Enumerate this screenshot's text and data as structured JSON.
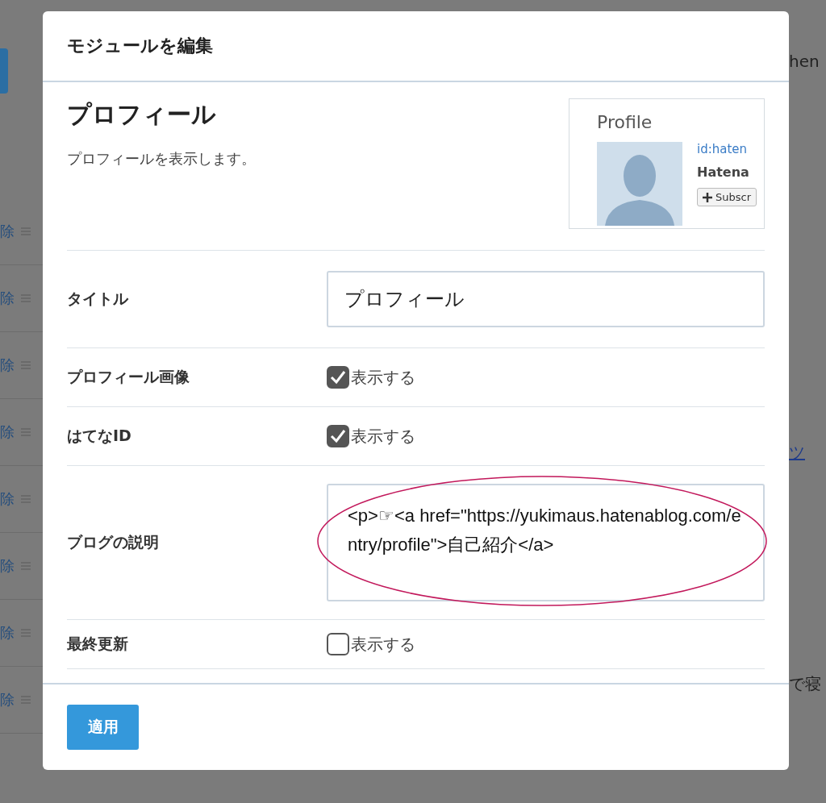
{
  "background": {
    "left_links": [
      "除",
      "除",
      "除",
      "除",
      "除",
      "除",
      "除",
      "除"
    ],
    "right_texts": [
      {
        "kind": "text",
        "text": "hen"
      },
      {
        "kind": "link",
        "text": "ツ"
      },
      {
        "kind": "text",
        "text": "で寝"
      }
    ]
  },
  "dialog": {
    "title": "モジュールを編集",
    "module": {
      "name": "プロフィール",
      "description": "プロフィールを表示します。",
      "preview": {
        "heading": "Profile",
        "id": "id:haten",
        "name": "Hatena",
        "button": "Subscr"
      }
    },
    "fields": [
      {
        "kind": "text",
        "label": "タイトル",
        "value": "プロフィール"
      },
      {
        "kind": "checkbox",
        "label": "プロフィール画像",
        "option": "表示する",
        "checked": true
      },
      {
        "kind": "checkbox",
        "label": "はてなID",
        "option": "表示する",
        "checked": true
      },
      {
        "kind": "textarea",
        "label": "ブログの説明",
        "value": "<p>☞<a href=\"https://yukimaus.hatenablog.com/entry/profile\">自己紹介</a>",
        "highlighted": true
      },
      {
        "kind": "checkbox",
        "label": "最終更新",
        "option": "表示する",
        "checked": false
      }
    ],
    "apply_button": "適用"
  }
}
